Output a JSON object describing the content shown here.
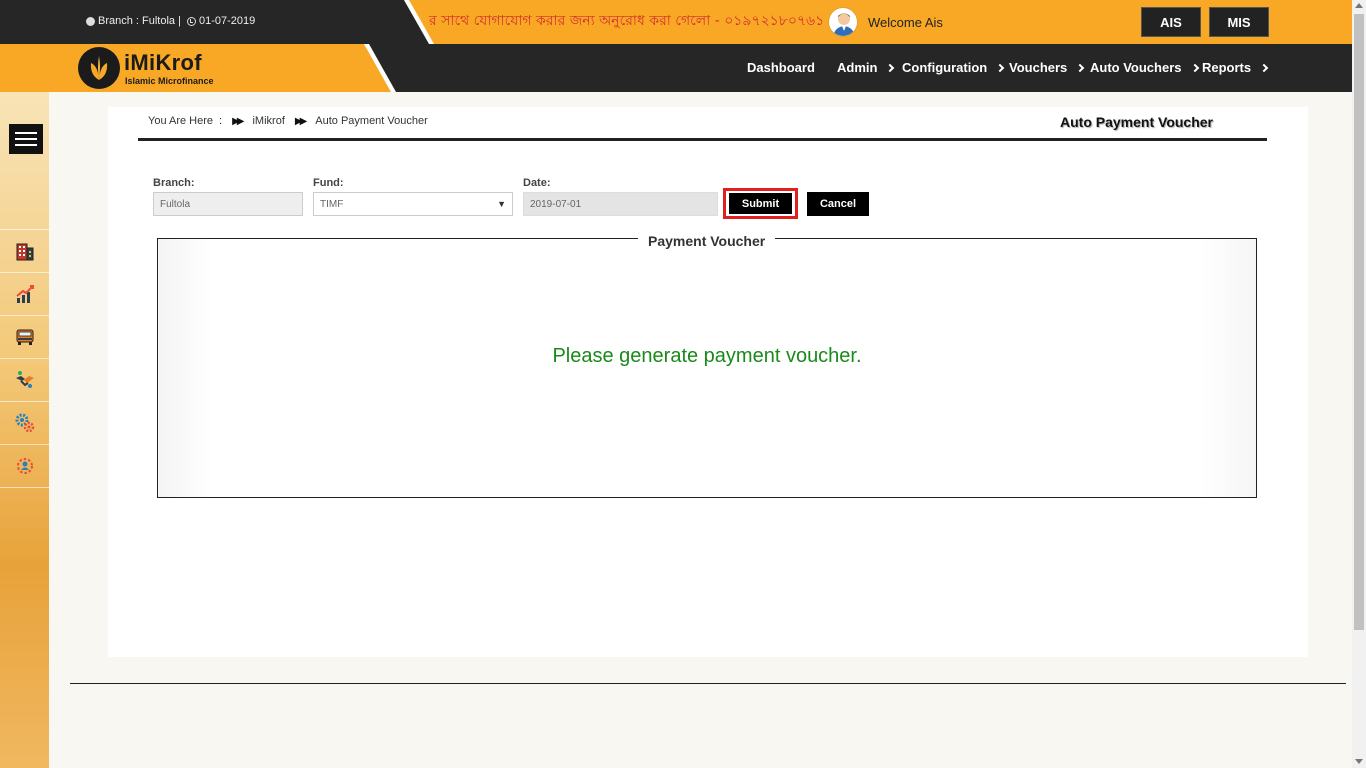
{
  "topbar": {
    "branch_text": "Branch : Fultola |",
    "date_text": "01-07-2019",
    "marquee": "র সাথে যোগাযোগ করার জন্য অনুরোধ করা গেলো - ০১৯৭২১৮০৭৬১",
    "welcome": "Welcome Ais",
    "ais_label": "AIS",
    "mis_label": "MIS"
  },
  "logo": {
    "name": "iMiKrof",
    "tagline": "Islamic Microfinance"
  },
  "nav": {
    "items": [
      {
        "label": "Dashboard"
      },
      {
        "label": "Admin"
      },
      {
        "label": "Configuration"
      },
      {
        "label": "Vouchers"
      },
      {
        "label": "Auto Vouchers"
      },
      {
        "label": "Reports"
      }
    ]
  },
  "sidebar": {
    "icons": [
      "building-icon",
      "chart-growth-icon",
      "car-icon",
      "handshake-icon",
      "gears-icon",
      "settings-user-icon"
    ]
  },
  "breadcrumb": {
    "prefix": "You Are Here",
    "sep": ":",
    "root": "iMikrof",
    "current": "Auto Payment Voucher"
  },
  "page_title": "Auto Payment Voucher",
  "form": {
    "branch_label": "Branch:",
    "branch_value": "Fultola",
    "fund_label": "Fund:",
    "fund_value": "TIMF",
    "date_label": "Date:",
    "date_value": "2019-07-01",
    "submit_label": "Submit",
    "cancel_label": "Cancel"
  },
  "voucher": {
    "legend": "Payment Voucher",
    "message": "Please generate payment voucher."
  },
  "colors": {
    "accent": "#f9a825",
    "dark": "#262626",
    "message_green": "#1a8a1a",
    "highlight_red": "#e0201c"
  }
}
